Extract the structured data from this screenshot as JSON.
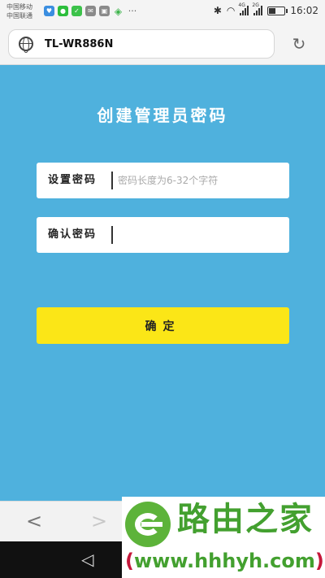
{
  "status_bar": {
    "carrier_line1": "中国移动",
    "carrier_line2": "中国联通",
    "notification_icons": [
      "bell-icon",
      "chat-icon",
      "wechat-icon",
      "message-icon",
      "image-icon",
      "wifi-shield-icon"
    ],
    "more": "···",
    "bluetooth": "bluetooth-icon",
    "sim1_tag": "4G",
    "sim2_tag": "2G",
    "time": "16:02"
  },
  "browser": {
    "url": "TL-WR886N",
    "refresh_icon": "refresh-icon",
    "back_icon": "<",
    "forward_icon": ">"
  },
  "page": {
    "title": "创建管理员密码",
    "password_label": "设置密码",
    "password_placeholder": "密码长度为6-32个字符",
    "confirm_label": "确认密码",
    "confirm_placeholder": "",
    "submit_label": "确定"
  },
  "nav": {
    "back": "◁"
  },
  "watermark": {
    "name": "路由之家",
    "url_open": "(",
    "url_host": "www.hhhyh.com",
    "url_close": ")"
  },
  "colors": {
    "background": "#4fb1dd",
    "button": "#fbe617",
    "watermark_green": "#43a02f",
    "watermark_red": "#c5173a"
  }
}
